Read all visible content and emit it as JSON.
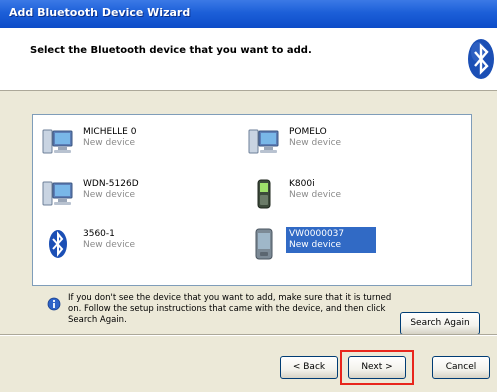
{
  "window": {
    "title": "Add Bluetooth Device Wizard"
  },
  "header": {
    "heading": "Select the Bluetooth device that you want to add.",
    "logo_icon": "bluetooth-icon"
  },
  "devices": [
    {
      "name": "MICHELLE 0",
      "status": "New device",
      "icon": "computer-icon",
      "selected": false
    },
    {
      "name": "POMELO",
      "status": "New device",
      "icon": "computer-icon",
      "selected": false
    },
    {
      "name": "WDN-5126D",
      "status": "New device",
      "icon": "computer-icon",
      "selected": false
    },
    {
      "name": "K800i",
      "status": "New device",
      "icon": "mobile-phone-icon",
      "selected": false
    },
    {
      "name": "3560-1",
      "status": "New device",
      "icon": "bluetooth-icon",
      "selected": false
    },
    {
      "name": "VW0000037",
      "status": "New device",
      "icon": "pda-icon",
      "selected": true
    }
  ],
  "hint": {
    "text": "If you don't see the device that you want to add, make sure that it is turned on. Follow the setup instructions that came with the device, and then click Search Again."
  },
  "buttons": {
    "search_again": "Search Again",
    "back": "< Back",
    "next": "Next >",
    "cancel": "Cancel"
  },
  "colors": {
    "title_bar": "#1c5fd8",
    "selection": "#316ac5",
    "highlight_box": "#e8261c"
  }
}
